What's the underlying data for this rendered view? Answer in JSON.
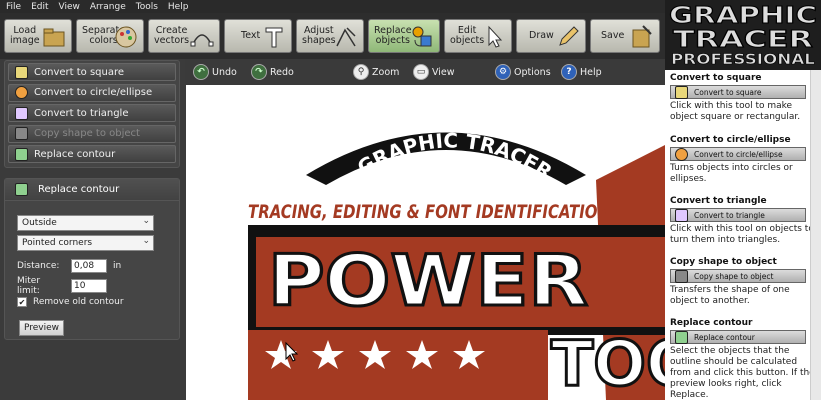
{
  "menu": [
    "File",
    "Edit",
    "View",
    "Arrange",
    "Tools",
    "Help"
  ],
  "toolbar": [
    {
      "label": "Load\nimage",
      "icon": "folder-icon"
    },
    {
      "label": "Separate\ncolors",
      "icon": "palette-icon"
    },
    {
      "label": "Create\nvectors",
      "icon": "vector-icon"
    },
    {
      "label": "Text",
      "icon": "text-icon"
    },
    {
      "label": "Adjust\nshapes",
      "icon": "adjust-icon"
    },
    {
      "label": "Replace\nobjects",
      "icon": "replace-icon"
    },
    {
      "label": "Edit\nobjects",
      "icon": "cursor-icon"
    },
    {
      "label": "Draw",
      "icon": "pencil-icon"
    },
    {
      "label": "Save",
      "icon": "save-icon"
    }
  ],
  "toolbar2": {
    "undo": "Undo",
    "redo": "Redo",
    "zoom": "Zoom",
    "view": "View",
    "options": "Options",
    "help": "Help"
  },
  "left_panel": {
    "items": [
      {
        "label": "Convert to square",
        "disabled": false
      },
      {
        "label": "Convert to circle/ellipse",
        "disabled": false
      },
      {
        "label": "Convert to triangle",
        "disabled": false
      },
      {
        "label": "Copy shape to object",
        "disabled": true
      },
      {
        "label": "Replace contour",
        "disabled": false
      }
    ]
  },
  "replace_contour": {
    "title": "Replace contour",
    "position_select": "Outside",
    "corners_select": "Pointed corners",
    "distance_label": "Distance:",
    "distance_value": "0,08",
    "distance_unit": "in",
    "miter_label": "Miter limit:",
    "miter_value": "10",
    "remove_old_label": "Remove old contour",
    "remove_old_checked": "✔",
    "preview_label": "Preview"
  },
  "canvas": {
    "arc_text": "GRAPHIC TRACER",
    "subtitle": "TRACING, EDITING & FONT IDENTIFICATION",
    "big_text": "POWER",
    "partial_text": "TOO"
  },
  "help": {
    "logo_line1": "GRAPHIC",
    "logo_line2": "TRACER",
    "logo_line3": "PROFESSIONAL",
    "sections": [
      {
        "title": "Convert to square",
        "button": "Convert to square",
        "text": "Click with this tool to make object square or rectangular."
      },
      {
        "title": "Convert to circle/ellipse",
        "button": "Convert to circle/ellipse",
        "text": "Turns objects into circles or ellipses."
      },
      {
        "title": "Convert to triangle",
        "button": "Convert to triangle",
        "text": "Click with this tool on objects to turn them into triangles."
      },
      {
        "title": "Copy shape to object",
        "button": "Copy shape to object",
        "text": "Transfers the shape of one object to another."
      },
      {
        "title": "Replace contour",
        "button": "Replace contour",
        "text": "Select the objects that the outline should be calculated from and click this button. If the preview looks right, click Replace."
      }
    ]
  },
  "colors": {
    "accent_red": "#a43a22",
    "dark_bg": "#3b3b3b",
    "logo_black": "#111111"
  }
}
